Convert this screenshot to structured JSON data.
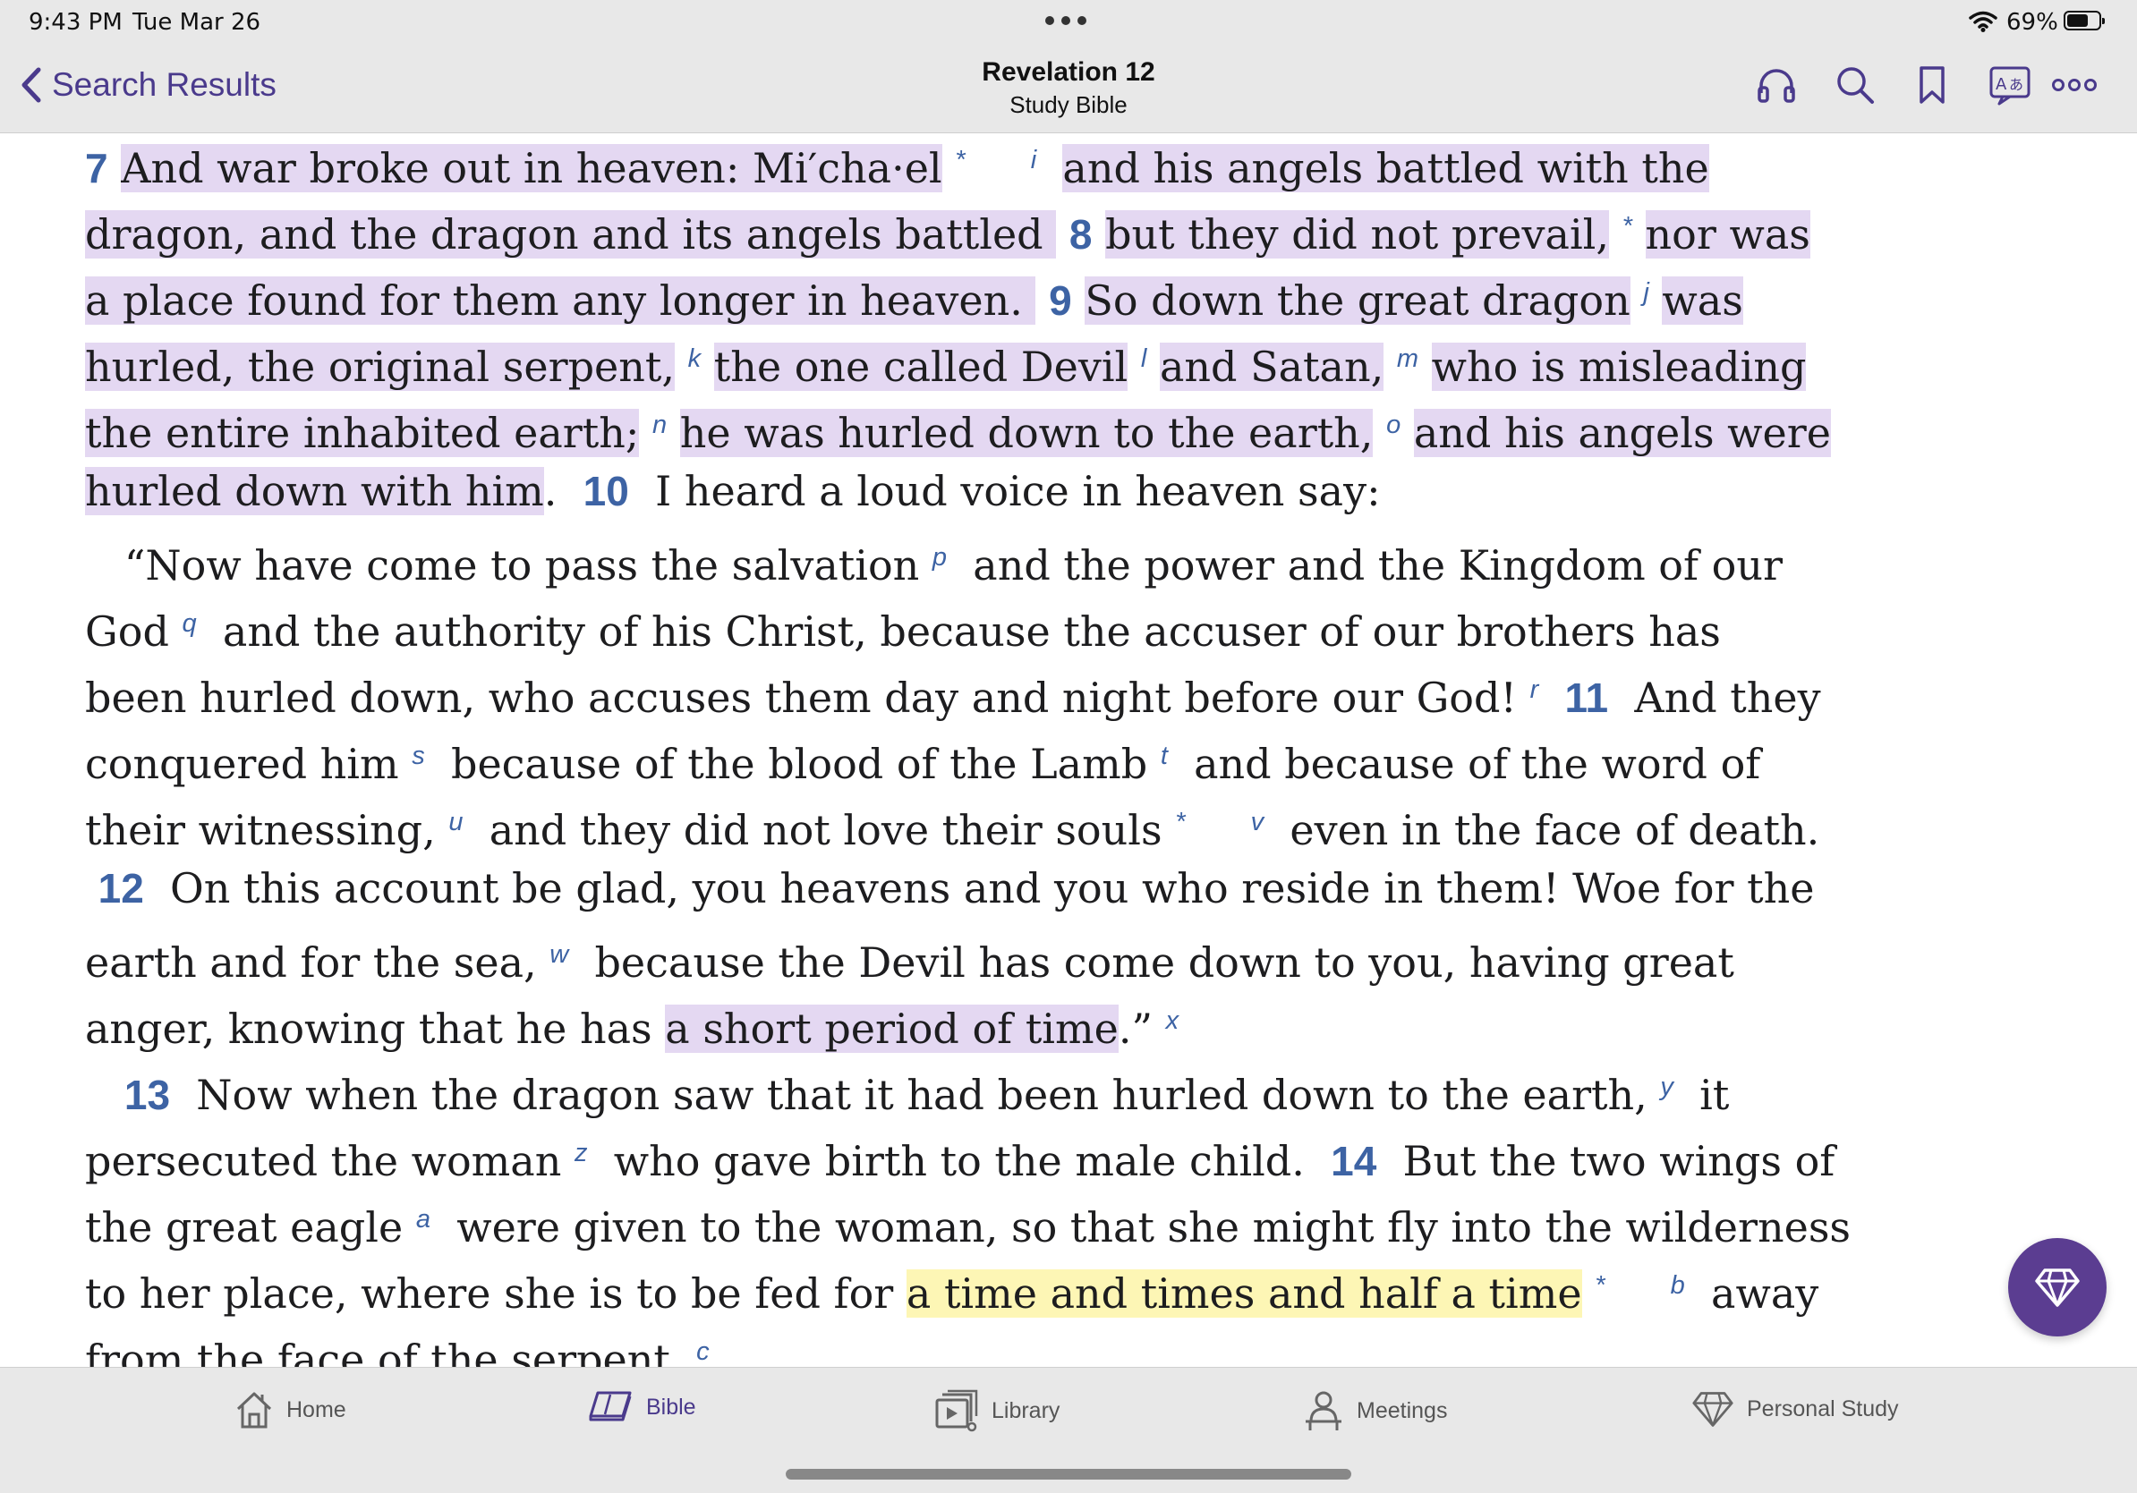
{
  "status_bar": {
    "time": "9:43 PM",
    "date": "Tue Mar 26",
    "battery_pct": "69%",
    "battery_level": 0.69
  },
  "nav": {
    "back_label": "Search Results",
    "title": "Revelation 12",
    "subtitle": "Study Bible",
    "icons": [
      "headphones-icon",
      "search-icon",
      "bookmark-icon",
      "translate-icon",
      "more-icon"
    ]
  },
  "content": {
    "lines": [
      [
        {
          "t": "7",
          "v": 1
        },
        {
          "t": " ",
          "s": 1
        },
        {
          "t": "And war broke out in heaven: Mi′cha·el",
          "h": "p"
        },
        {
          "t": " ",
          "s": 1
        },
        {
          "t": "*",
          "f": 1
        },
        {
          "t": "     ",
          "s": 1
        },
        {
          "t": "i",
          "f": 1
        },
        {
          "t": "  ",
          "s": 1
        },
        {
          "t": "and his angels battled with the",
          "h": "p"
        }
      ],
      [
        {
          "t": "dragon, and the dragon and its angels battled ",
          "h": "p"
        },
        {
          "t": " ",
          "s": 1
        },
        {
          "t": "8",
          "v": 1
        },
        {
          "t": " ",
          "s": 1
        },
        {
          "t": "but they did not prevail,",
          "h": "p"
        },
        {
          "t": " ",
          "s": 1
        },
        {
          "t": "*",
          "f": 1
        },
        {
          "t": " ",
          "s": 1
        },
        {
          "t": "nor was",
          "h": "p"
        }
      ],
      [
        {
          "t": "a place found for them any longer in heaven. ",
          "h": "p"
        },
        {
          "t": " ",
          "s": 1
        },
        {
          "t": "9",
          "v": 1
        },
        {
          "t": " ",
          "s": 1
        },
        {
          "t": "So down the great dragon",
          "h": "p"
        },
        {
          "t": " ",
          "s": 1
        },
        {
          "t": "j",
          "f": 1
        },
        {
          "t": " ",
          "s": 1
        },
        {
          "t": "was",
          "h": "p"
        }
      ],
      [
        {
          "t": "hurled, the original serpent,",
          "h": "p"
        },
        {
          "t": " ",
          "s": 1
        },
        {
          "t": "k",
          "f": 1
        },
        {
          "t": " ",
          "s": 1
        },
        {
          "t": "the one called Devil",
          "h": "p"
        },
        {
          "t": " ",
          "s": 1
        },
        {
          "t": "l",
          "f": 1
        },
        {
          "t": " ",
          "s": 1
        },
        {
          "t": "and Satan,",
          "h": "p"
        },
        {
          "t": " ",
          "s": 1
        },
        {
          "t": "m",
          "f": 1
        },
        {
          "t": " ",
          "s": 1
        },
        {
          "t": "who is misleading",
          "h": "p"
        }
      ],
      [
        {
          "t": "the entire inhabited earth;",
          "h": "p"
        },
        {
          "t": " ",
          "s": 1
        },
        {
          "t": "n",
          "f": 1
        },
        {
          "t": " ",
          "s": 1
        },
        {
          "t": "he was hurled down to the earth,",
          "h": "p"
        },
        {
          "t": " ",
          "s": 1
        },
        {
          "t": "o",
          "f": 1
        },
        {
          "t": " ",
          "s": 1
        },
        {
          "t": "and his angels were",
          "h": "p"
        }
      ],
      [
        {
          "t": "hurled down with him",
          "h": "p"
        },
        {
          "t": ".  "
        },
        {
          "t": "10",
          "v": 1
        },
        {
          "t": "  I heard a loud voice in heaven say:"
        }
      ],
      [
        {
          "t": "   “Now have come to pass the salvation"
        },
        {
          "t": " ",
          "s": 1
        },
        {
          "t": "p",
          "f": 1
        },
        {
          "t": "  and the power and the Kingdom of our"
        }
      ],
      [
        {
          "t": "God"
        },
        {
          "t": " ",
          "s": 1
        },
        {
          "t": "q",
          "f": 1
        },
        {
          "t": "  and the authority of his Christ, because the accuser of our brothers has"
        }
      ],
      [
        {
          "t": "been hurled down, who accuses them day and night before our God!"
        },
        {
          "t": " ",
          "s": 1
        },
        {
          "t": "r",
          "f": 1
        },
        {
          "t": "  "
        },
        {
          "t": "11",
          "v": 1
        },
        {
          "t": "  And they"
        }
      ],
      [
        {
          "t": "conquered him"
        },
        {
          "t": " ",
          "s": 1
        },
        {
          "t": "s",
          "f": 1
        },
        {
          "t": "  because of the blood of the Lamb"
        },
        {
          "t": " ",
          "s": 1
        },
        {
          "t": "t",
          "f": 1
        },
        {
          "t": "  and because of the word of"
        }
      ],
      [
        {
          "t": "their witnessing,"
        },
        {
          "t": " ",
          "s": 1
        },
        {
          "t": "u",
          "f": 1
        },
        {
          "t": "  and they did not love their souls "
        },
        {
          "t": "*",
          "f": 1
        },
        {
          "t": "     ",
          "s": 1
        },
        {
          "t": "v",
          "f": 1
        },
        {
          "t": "  even in the face of death."
        }
      ],
      [
        {
          "t": " "
        },
        {
          "t": "12",
          "v": 1
        },
        {
          "t": "  On this account be glad, you heavens and you who reside in them! Woe for the"
        }
      ],
      [
        {
          "t": "earth and for the sea,"
        },
        {
          "t": " ",
          "s": 1
        },
        {
          "t": "w",
          "f": 1
        },
        {
          "t": "  because the Devil has come down to you, having great"
        }
      ],
      [
        {
          "t": "anger, knowing that he has "
        },
        {
          "t": "a short period of time",
          "h": "p"
        },
        {
          "t": ".”"
        },
        {
          "t": " ",
          "s": 1
        },
        {
          "t": "x",
          "f": 1
        }
      ],
      [
        {
          "t": "   "
        },
        {
          "t": "13",
          "v": 1
        },
        {
          "t": "  Now when the dragon saw that it had been hurled down to the earth,"
        },
        {
          "t": " ",
          "s": 1
        },
        {
          "t": "y",
          "f": 1
        },
        {
          "t": "  it"
        }
      ],
      [
        {
          "t": "persecuted the woman"
        },
        {
          "t": " ",
          "s": 1
        },
        {
          "t": "z",
          "f": 1
        },
        {
          "t": "  who gave birth to the male child.  "
        },
        {
          "t": "14",
          "v": 1
        },
        {
          "t": "  But the two wings of"
        }
      ],
      [
        {
          "t": "the great eagle"
        },
        {
          "t": " ",
          "s": 1
        },
        {
          "t": "a",
          "f": 1
        },
        {
          "t": "  were given to the woman, so that she might fly into the wilderness"
        }
      ],
      [
        {
          "t": "to her place, where she is to be fed for "
        },
        {
          "t": "a time and times and half a time",
          "h": "y"
        },
        {
          "t": " ",
          "s": 1
        },
        {
          "t": "*",
          "f": 1
        },
        {
          "t": "     ",
          "s": 1
        },
        {
          "t": "b",
          "f": 1
        },
        {
          "t": "  away"
        }
      ],
      [
        {
          "t": "from the face of the serpent."
        },
        {
          "t": " ",
          "s": 1
        },
        {
          "t": "c",
          "f": 1
        }
      ]
    ]
  },
  "tabs": [
    {
      "label": "Home",
      "icon": "home-icon",
      "active": false
    },
    {
      "label": "Bible",
      "icon": "bible-icon",
      "active": true
    },
    {
      "label": "Library",
      "icon": "library-icon",
      "active": false
    },
    {
      "label": "Meetings",
      "icon": "meetings-icon",
      "active": false
    },
    {
      "label": "Personal Study",
      "icon": "gem-icon",
      "active": false
    }
  ],
  "colors": {
    "accent": "#4a3a8c",
    "verse_number": "#3d63a4",
    "highlight_purple": "#e4d8f2",
    "highlight_yellow": "#fdf6b5",
    "fab": "#5b3d91"
  }
}
